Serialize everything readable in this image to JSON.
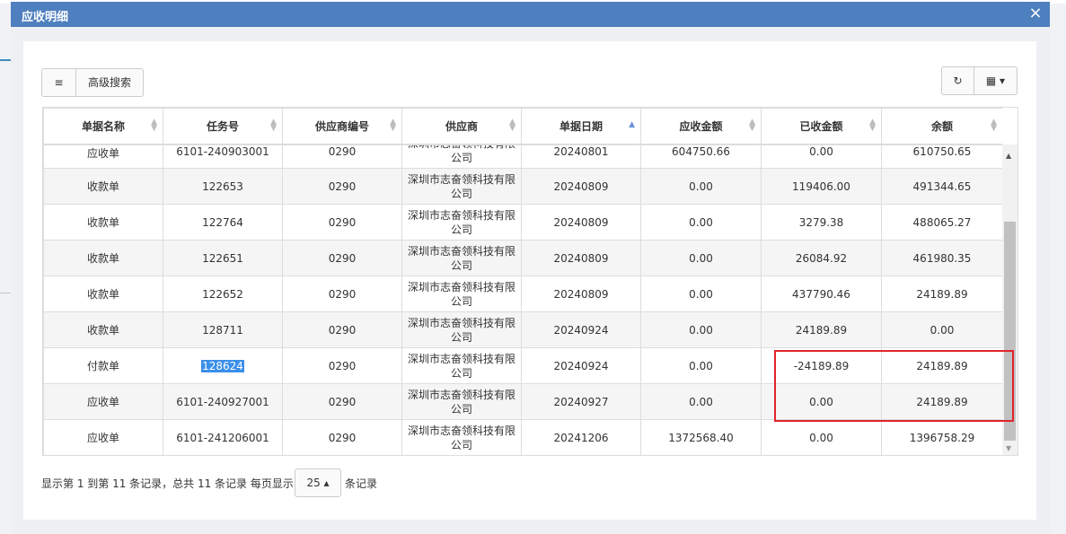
{
  "modal": {
    "title": "应收明细",
    "close": "×"
  },
  "toolbar": {
    "list_icon": "≡",
    "advanced_search": "高级搜索",
    "refresh_icon": "↻",
    "columns_icon": "▦ ▾"
  },
  "table": {
    "headers": [
      "单据名称",
      "任务号",
      "供应商编号",
      "供应商",
      "单据日期",
      "应收金额",
      "已收金额",
      "余额"
    ],
    "rows": [
      [
        "应收单",
        "6101-240903001",
        "0290",
        "深圳市志奋领科技有限公司",
        "20240801",
        "604750.66",
        "0.00",
        "610750.65"
      ],
      [
        "收款单",
        "122653",
        "0290",
        "深圳市志奋领科技有限公司",
        "20240809",
        "0.00",
        "119406.00",
        "491344.65"
      ],
      [
        "收款单",
        "122764",
        "0290",
        "深圳市志奋领科技有限公司",
        "20240809",
        "0.00",
        "3279.38",
        "488065.27"
      ],
      [
        "收款单",
        "122651",
        "0290",
        "深圳市志奋领科技有限公司",
        "20240809",
        "0.00",
        "26084.92",
        "461980.35"
      ],
      [
        "收款单",
        "122652",
        "0290",
        "深圳市志奋领科技有限公司",
        "20240809",
        "0.00",
        "437790.46",
        "24189.89"
      ],
      [
        "收款单",
        "128711",
        "0290",
        "深圳市志奋领科技有限公司",
        "20240924",
        "0.00",
        "24189.89",
        "0.00"
      ],
      [
        "付款单",
        "128624",
        "0290",
        "深圳市志奋领科技有限公司",
        "20240924",
        "0.00",
        "-24189.89",
        "24189.89"
      ],
      [
        "应收单",
        "6101-240927001",
        "0290",
        "深圳市志奋领科技有限公司",
        "20240927",
        "0.00",
        "0.00",
        "24189.89"
      ],
      [
        "应收单",
        "6101-241206001",
        "0290",
        "深圳市志奋领科技有限公司",
        "20241206",
        "1372568.40",
        "0.00",
        "1396758.29"
      ]
    ]
  },
  "pagination": {
    "summary": "显示第 1 到第 11 条记录，总共 11 条记录 每页显示",
    "page_size": "25 ▴",
    "suffix": "条记录"
  }
}
